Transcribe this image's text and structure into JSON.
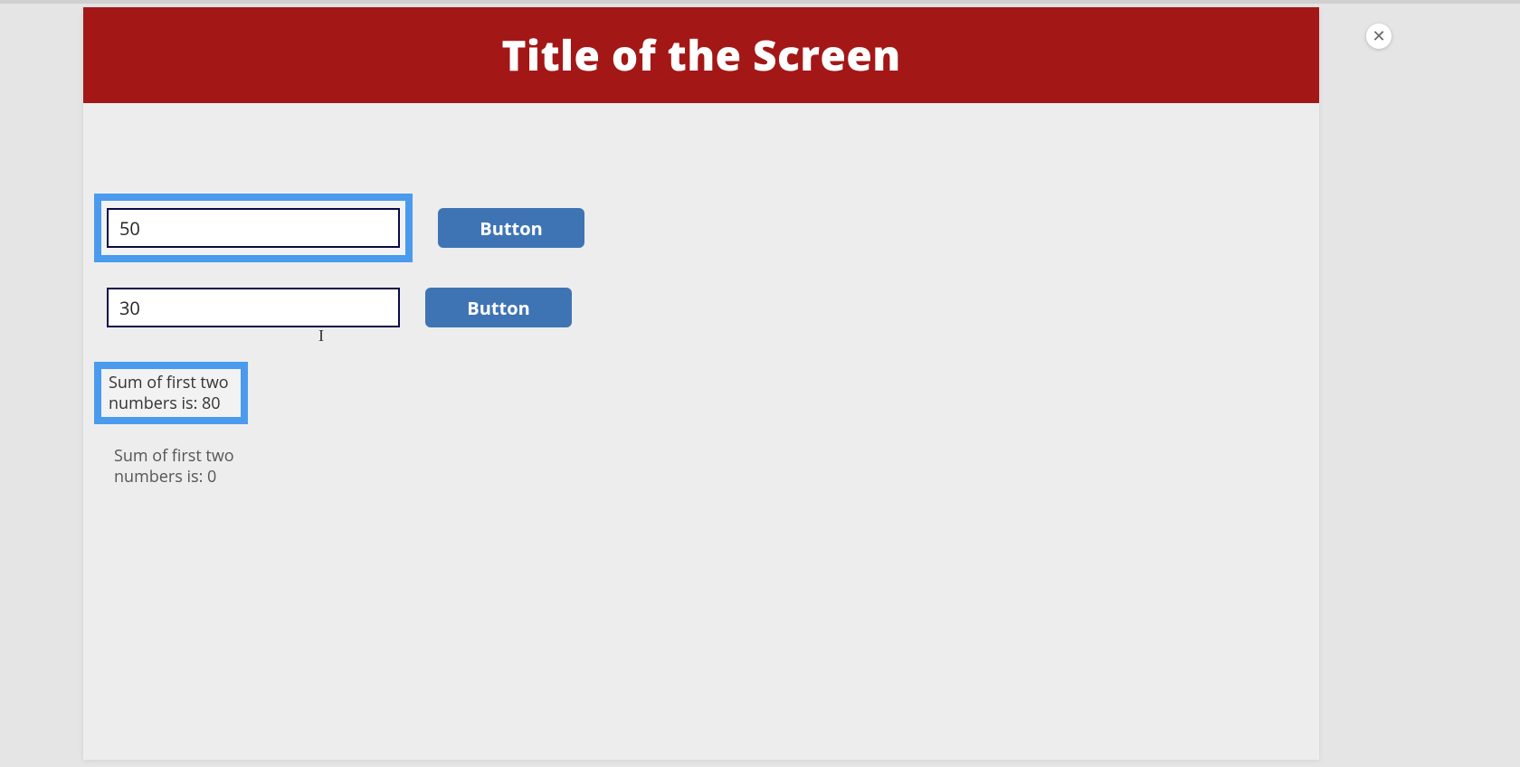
{
  "header": {
    "title": "Title of the Screen"
  },
  "close": {
    "glyph": "✕"
  },
  "form": {
    "input1": {
      "value": "50"
    },
    "input2": {
      "value": "30"
    },
    "button1_label": "Button",
    "button2_label": "Button"
  },
  "results": {
    "primary": "Sum of first two numbers is: 80",
    "secondary": "Sum of first two numbers is: 0"
  }
}
